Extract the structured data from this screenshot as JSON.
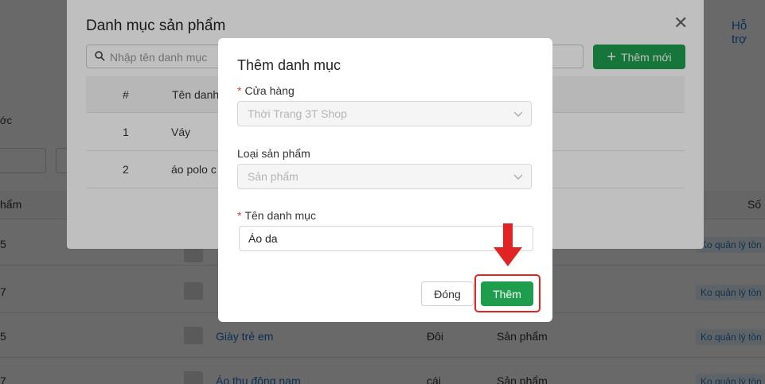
{
  "background": {
    "support_link": "Hỗ trợ",
    "left_fragment_1": "ớc",
    "left_fragment_2": "hẩm",
    "column_right": "Số",
    "rows": [
      {
        "left": "5",
        "name": "",
        "unit": "",
        "type": "",
        "badge": "Ko quản lý tồn"
      },
      {
        "left": "7",
        "name": "",
        "unit": "",
        "type": "",
        "badge": "Ko quản lý tồn"
      },
      {
        "left": "5",
        "name": "Giày trẻ em",
        "unit": "Đôi",
        "type": "Sản phẩm",
        "badge": "Ko quản lý tồn"
      },
      {
        "left": "7",
        "name": "Áo thu đông nam",
        "unit": "cái",
        "type": "Sản phẩm",
        "badge": "Ko quản lý tồn"
      }
    ]
  },
  "outer_modal": {
    "title": "Danh mục sản phẩm",
    "search_placeholder": "Nhập tên danh mục",
    "add_button": "Thêm mới",
    "table": {
      "headers": [
        "#",
        "Tên danh"
      ],
      "rows": [
        {
          "index": "1",
          "name": "Váy"
        },
        {
          "index": "2",
          "name": "áo polo c"
        }
      ]
    }
  },
  "inner_modal": {
    "title": "Thêm danh mục",
    "store_label": "Cửa hàng",
    "store_value": "Thời Trang 3T Shop",
    "product_type_label": "Loại sản phẩm",
    "product_type_value": "Sản phẩm",
    "category_name_label": "Tên danh mục",
    "category_name_value": "Áo da",
    "close_button": "Đóng",
    "submit_button": "Thêm"
  },
  "colors": {
    "primary_green": "#1e9e4d",
    "highlight_red": "#e02424",
    "link_blue": "#1a73c8"
  }
}
